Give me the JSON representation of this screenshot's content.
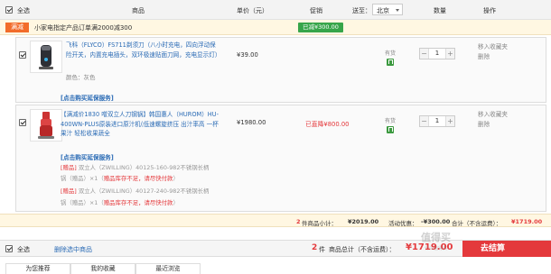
{
  "header": {
    "select_all": "全选",
    "col_product": "商品",
    "col_unit_price": "单价（元）",
    "col_promo": "促销",
    "col_ship_to": "送至：",
    "region": "北京",
    "col_qty": "数量",
    "col_op": "操作"
  },
  "promo": {
    "tag": "满减",
    "text": "小家电指定产品订单满2000减300",
    "saved": "已减¥300.00"
  },
  "items": [
    {
      "name": "飞科（FLYCO）FS711剃须刀（八小时充电，四向浮动保险开关，内置充电插头，双环极速贴面刀网，充电显示灯）",
      "color": "颜色：灰色",
      "service": "[点击购买延保服务]",
      "price": "¥39.00",
      "promo": "",
      "stock": "有货",
      "qty": "1",
      "op_favorite": "移入收藏夹",
      "op_delete": "删除"
    },
    {
      "name": "【满减价1830 噌双立人刀钢锅】韩国惠人（HUROM）HU-400WN-PLUS原装进口原汁机(低速螺旋挤压 出汁率高 一杯果汁 轻松收果蔬全",
      "service": "[点击购买延保服务]",
      "price": "¥1980.00",
      "promo": "已直降¥800.00",
      "stock": "有货",
      "qty": "1",
      "op_favorite": "移入收藏夹",
      "op_delete": "删除",
      "gifts": [
        {
          "tag": "[赠品]",
          "line1": " 双立人（ZWILLING）40125-160-982不锈钢长柄",
          "line2_prefix": "锅（赠品）×1（",
          "line2_warn": "赠品库存不足，请尽快付款",
          "line2_suffix": "）"
        },
        {
          "tag": "[赠品]",
          "line1": " 双立人（ZWILLING）40127-240-982不锈钢长柄",
          "line2_prefix": "锅（赠品）×1（",
          "line2_warn": "赠品库存不足，请尽快付款",
          "line2_suffix": "）"
        }
      ]
    }
  ],
  "subtotal": {
    "count": "2",
    "count_label": "件商品小计：",
    "amount": "¥2019.00",
    "discount_label": "活动优惠：",
    "discount": "-¥300.00",
    "total_label": "合计（不含运费）：",
    "total": "¥1719.00"
  },
  "bottom": {
    "select_all": "全选",
    "delete_selected": "删除选中商品",
    "count": "2",
    "count_label": "件",
    "total_label": "商品总计（不含运费）：",
    "total": "¥1719.00",
    "checkout": "去结算",
    "checkout_arrow": "›"
  },
  "watermark": {
    "text": "值得买",
    "sub": "什么值得买"
  },
  "tabs": [
    "为您推荐",
    "我的收藏",
    "最近浏览"
  ],
  "colors": {
    "accent_red": "#e4393c",
    "link_blue": "#2a6bb5",
    "promo_orange": "#f26c2a",
    "saved_green": "#37a54a"
  }
}
